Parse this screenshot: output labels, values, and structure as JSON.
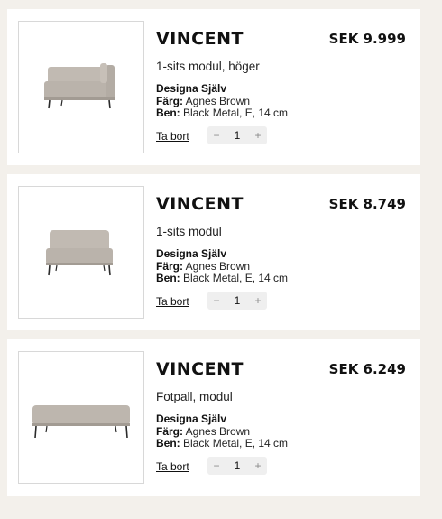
{
  "cart": {
    "items": [
      {
        "title": "VINCENT",
        "price": "SEK 9.999",
        "variant": "1-sits modul, höger",
        "design_label": "Designa Själv",
        "color_label": "Färg:",
        "color_value": "Agnes Brown",
        "legs_label": "Ben:",
        "legs_value": "Black Metal, E, 14 cm",
        "remove_label": "Ta bort",
        "quantity": "1",
        "minus": "−",
        "plus": "+"
      },
      {
        "title": "VINCENT",
        "price": "SEK 8.749",
        "variant": "1-sits modul",
        "design_label": "Designa Själv",
        "color_label": "Färg:",
        "color_value": "Agnes Brown",
        "legs_label": "Ben:",
        "legs_value": "Black Metal, E, 14 cm",
        "remove_label": "Ta bort",
        "quantity": "1",
        "minus": "−",
        "plus": "+"
      },
      {
        "title": "VINCENT",
        "price": "SEK 6.249",
        "variant": "Fotpall, modul",
        "design_label": "Designa Själv",
        "color_label": "Färg:",
        "color_value": "Agnes Brown",
        "legs_label": "Ben:",
        "legs_value": "Black Metal, E, 14 cm",
        "remove_label": "Ta bort",
        "quantity": "1",
        "minus": "−",
        "plus": "+"
      }
    ]
  },
  "colors": {
    "page_background": "#f3f0eb",
    "card_background": "#ffffff",
    "fabric": "#bdb6ae",
    "legs": "#2a2a2a"
  }
}
